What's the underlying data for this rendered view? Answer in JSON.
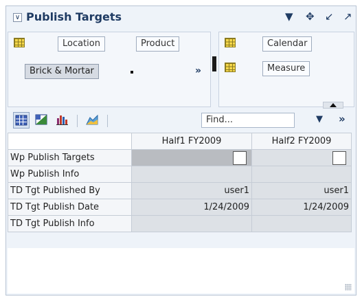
{
  "panel": {
    "title": "Publish Targets",
    "collapse_glyph": "∨",
    "header_icons": [
      {
        "name": "menu-dropdown-icon",
        "glyph": "▼"
      },
      {
        "name": "move-icon",
        "glyph": "✥"
      },
      {
        "name": "dock-icon",
        "glyph": "↙"
      },
      {
        "name": "undock-icon",
        "glyph": "↗"
      }
    ]
  },
  "dimensions": {
    "rows_area": {
      "chips": [
        "Location",
        "Product"
      ],
      "page_chip": "Brick & Mortar",
      "more_glyph": "»"
    },
    "columns_area": {
      "chips": [
        "Calendar",
        "Measure"
      ]
    }
  },
  "toolbar": {
    "find_placeholder": "Find...",
    "more_glyph": "»",
    "dropdown_glyph": "▼"
  },
  "grid": {
    "columns": [
      "Half1 FY2009",
      "Half2 FY2009"
    ],
    "rows": [
      {
        "label": "Wp Publish Targets",
        "type": "checkbox",
        "values": [
          "",
          ""
        ]
      },
      {
        "label": "Wp Publish Info",
        "type": "text",
        "values": [
          "",
          ""
        ]
      },
      {
        "label": "TD Tgt Published By",
        "type": "text",
        "values": [
          "user1",
          "user1"
        ]
      },
      {
        "label": "TD Tgt Publish Date",
        "type": "text",
        "values": [
          "1/24/2009",
          "1/24/2009"
        ]
      },
      {
        "label": "TD Tgt Publish Info",
        "type": "text",
        "values": [
          "",
          ""
        ]
      }
    ]
  },
  "colors": {
    "title": "#1f3b63",
    "panel_bg": "#eef3f9",
    "selected_cell": "#b9bcc1",
    "cell": "#dde1e6"
  }
}
